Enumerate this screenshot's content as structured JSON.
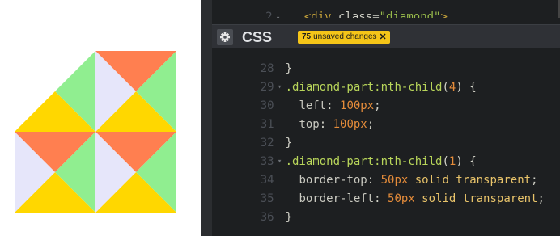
{
  "html_panel": {
    "line_number": "2",
    "tag_open": "<div",
    "attr_name": "class",
    "attr_eq": "=",
    "attr_value": "\"diamond\"",
    "tag_close": ">"
  },
  "css_panel": {
    "title": "CSS",
    "unsaved_count": "75",
    "unsaved_label": "unsaved changes",
    "close_glyph": "✕"
  },
  "code_lines": [
    {
      "num": "28",
      "fold": "",
      "text": "}"
    },
    {
      "num": "29",
      "fold": "▾",
      "selector": ".diamond-part",
      "pseudo": ":nth-child",
      "arg": "4",
      "tail": " {"
    },
    {
      "num": "30",
      "fold": "",
      "prop": "left",
      "value_num": "100px",
      "value_rest": ";"
    },
    {
      "num": "31",
      "fold": "",
      "prop": "top",
      "value_num": "100px",
      "value_rest": ";"
    },
    {
      "num": "32",
      "fold": "",
      "text": "}"
    },
    {
      "num": "33",
      "fold": "▾",
      "selector": ".diamond-part",
      "pseudo": ":nth-child",
      "arg": "1",
      "tail": " {"
    },
    {
      "num": "34",
      "fold": "",
      "prop": "border-top",
      "value_num": "50px",
      "value_kw": "solid",
      "value_kw2": "transparent",
      "value_rest": ";"
    },
    {
      "num": "35",
      "fold": "",
      "prop": "border-left",
      "value_num": "50px",
      "value_kw": "solid",
      "value_kw2": "transparent",
      "value_rest": ";"
    },
    {
      "num": "36",
      "fold": "",
      "text": "}"
    }
  ],
  "preview_colors": {
    "orange": "#ff7f50",
    "green": "#90ee90",
    "lavender": "#e6e6fa",
    "gold": "#ffd700"
  }
}
